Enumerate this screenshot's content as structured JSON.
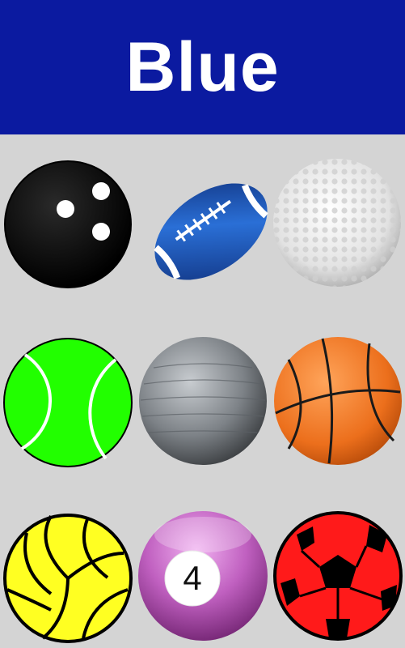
{
  "header": {
    "title": "Blue",
    "background": "#0b1aa0"
  },
  "balls": [
    {
      "name": "bowling-ball",
      "icon": "bowling-ball-icon",
      "color": "#000000"
    },
    {
      "name": "american-football",
      "icon": "american-football-icon",
      "color": "#1f5bc4"
    },
    {
      "name": "golf-ball",
      "icon": "golf-ball-icon",
      "color": "#f0f0f0"
    },
    {
      "name": "tennis-ball",
      "icon": "tennis-ball-icon",
      "color": "#22ff00"
    },
    {
      "name": "exercise-ball",
      "icon": "exercise-ball-icon",
      "color": "#8a8f94"
    },
    {
      "name": "basketball",
      "icon": "basketball-icon",
      "color": "#f07a2a"
    },
    {
      "name": "volleyball",
      "icon": "volleyball-icon",
      "color": "#ffff22"
    },
    {
      "name": "billiard-ball",
      "icon": "billiard-ball-icon",
      "color": "#c060c0",
      "number": "4"
    },
    {
      "name": "soccer-ball",
      "icon": "soccer-ball-icon",
      "color": "#ff1a1a"
    }
  ]
}
